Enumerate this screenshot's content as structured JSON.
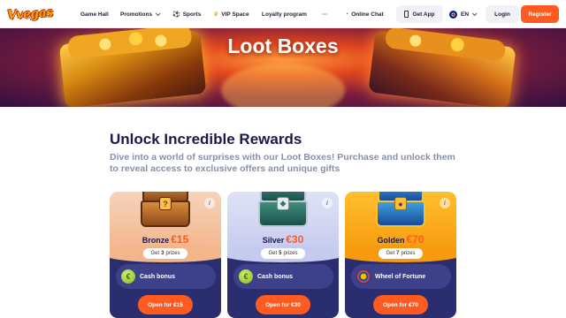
{
  "brand": {
    "logo_text": "Vvegas",
    "accent": "#ff5a1f"
  },
  "nav": {
    "game_hall": "Game Hall",
    "promotions": "Promotions",
    "sports": "Sports",
    "vip_space": "VIP Space",
    "loyalty": "Loyalty program",
    "more": "···",
    "online_chat": "Online Chat",
    "get_app": "Get App",
    "language": "EN",
    "login": "Login",
    "register": "Register"
  },
  "banner": {
    "title": "Loot Boxes"
  },
  "main": {
    "title": "Unlock Incredible Rewards",
    "subtitle": "Dive into a world of surprises with our Loot Boxes! Purchase and unlock them to reveal access to exclusive offers and unique gifts"
  },
  "cards": [
    {
      "name": "Bronze",
      "price": "€15",
      "prizes_prefix": "Get",
      "prizes_count": "3",
      "prizes_suffix": "prizes",
      "prize": "Cash bonus",
      "button": "Open for €15",
      "color": "#f3b58a"
    },
    {
      "name": "Silver",
      "price": "€30",
      "prizes_prefix": "Get",
      "prizes_count": "5",
      "prizes_suffix": "prizes",
      "prize": "Cash bonus",
      "button": "Open for €30",
      "color": "#c5cbef"
    },
    {
      "name": "Golden",
      "price": "€70",
      "prizes_prefix": "Get",
      "prizes_count": "7",
      "prizes_suffix": "prizes",
      "prize": "Wheel of Fortune",
      "button": "Open for €70",
      "color": "#f79a0e"
    }
  ]
}
